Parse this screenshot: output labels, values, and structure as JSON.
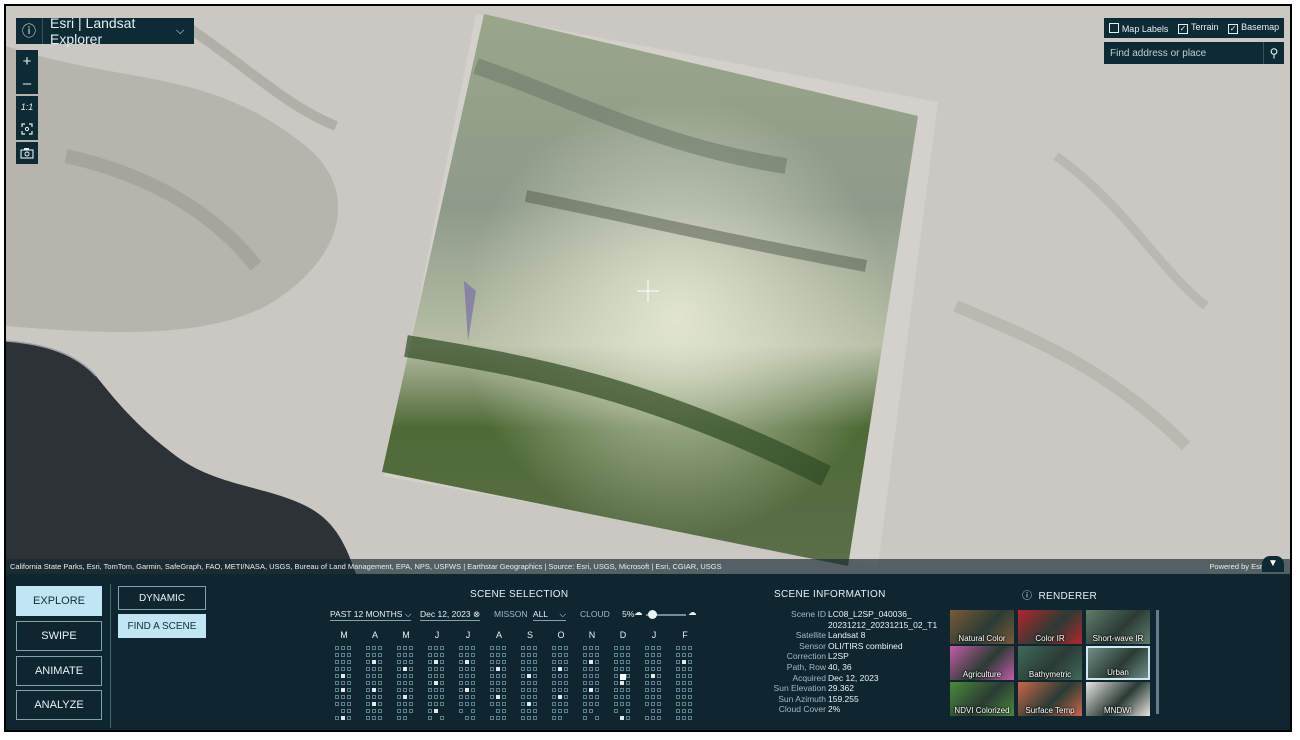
{
  "app": {
    "title": "Esri | Landsat Explorer",
    "info_icon": "info-icon",
    "chevron": "chevron-down-icon"
  },
  "map_controls": {
    "zoom_in": "+",
    "zoom_out": "–",
    "one_to_one": "1:1",
    "fit_icon": "fit-extent-icon",
    "screenshot_icon": "camera-icon"
  },
  "layer_toggles": [
    {
      "label": "Map Labels",
      "checked": false
    },
    {
      "label": "Terrain",
      "checked": true
    },
    {
      "label": "Basemap",
      "checked": true
    }
  ],
  "search": {
    "placeholder": "Find address or place"
  },
  "attribution": {
    "left": "California State Parks, Esri, TomTom, Garmin, SafeGraph, FAO, METI/NASA, USGS, Bureau of Land Management, EPA, NPS, USFWS | Earthstar Geographics | Source: Esri, USGS, Microsoft | Esri, CGIAR, USGS",
    "right": "Powered by Esri"
  },
  "modes": [
    {
      "label": "EXPLORE",
      "active": true
    },
    {
      "label": "SWIPE",
      "active": false
    },
    {
      "label": "ANIMATE",
      "active": false
    },
    {
      "label": "ANALYZE",
      "active": false
    }
  ],
  "explore_submodes": [
    {
      "label": "DYNAMIC",
      "active": false
    },
    {
      "label": "FIND A SCENE",
      "active": true
    }
  ],
  "scene_selection": {
    "title": "SCENE SELECTION",
    "period": "PAST 12 MONTHS",
    "date": "Dec 12, 2023",
    "mission_label": "MISSON",
    "mission_value": "ALL",
    "cloud_label": "CLOUD",
    "cloud_value": "5%",
    "months": [
      "M",
      "A",
      "M",
      "J",
      "J",
      "A",
      "S",
      "O",
      "N",
      "D",
      "J",
      "F"
    ]
  },
  "scene_info": {
    "title": "SCENE INFORMATION",
    "rows": [
      {
        "key": "Scene ID",
        "value": "LC08_L2SP_040036_"
      },
      {
        "key": "",
        "value": "20231212_20231215_02_T1"
      },
      {
        "key": "Satellite",
        "value": "Landsat 8"
      },
      {
        "key": "Sensor",
        "value": "OLI/TIRS combined"
      },
      {
        "key": "Correction",
        "value": "L2SP"
      },
      {
        "key": "Path, Row",
        "value": "40, 36"
      },
      {
        "key": "Acquired",
        "value": "Dec 12, 2023"
      },
      {
        "key": "Sun Elevation",
        "value": "29.362"
      },
      {
        "key": "Sun Azimuth",
        "value": "159.255"
      },
      {
        "key": "Cloud Cover",
        "value": "2%"
      }
    ]
  },
  "renderer": {
    "title": "RENDERER",
    "items": [
      {
        "label": "Natural Color",
        "color": "#7a5a3a",
        "selected": false
      },
      {
        "label": "Color IR",
        "color": "#b3262c",
        "selected": false
      },
      {
        "label": "Short-wave IR",
        "color": "#5f7c6a",
        "selected": false
      },
      {
        "label": "Agriculture",
        "color": "#c45ca8",
        "selected": false
      },
      {
        "label": "Bathymetric",
        "color": "#3f6a5a",
        "selected": false
      },
      {
        "label": "Urban",
        "color": "#6f8f86",
        "selected": true
      },
      {
        "label": "NDVI Colorized",
        "color": "#4b8a3a",
        "selected": false
      },
      {
        "label": "Surface Temp",
        "color": "#c9654a",
        "selected": false
      },
      {
        "label": "MNDWI",
        "color": "#e8e4e0",
        "selected": false
      }
    ]
  }
}
